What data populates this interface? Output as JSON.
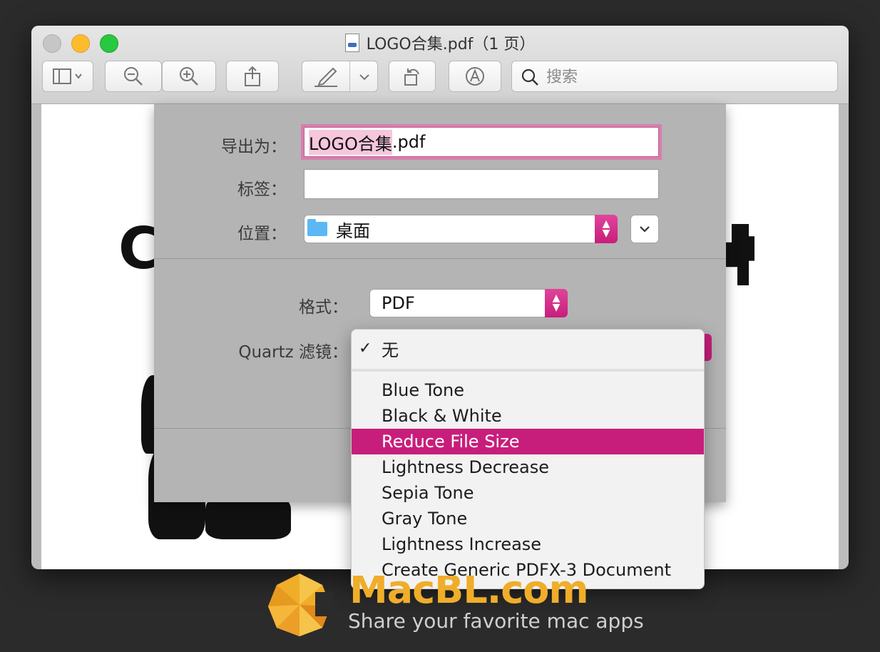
{
  "window": {
    "title": "LOGO合集.pdf（1 页）"
  },
  "toolbar": {
    "search_placeholder": "搜索",
    "icons": [
      "sidebar-icon",
      "zoom-out-icon",
      "zoom-in-icon",
      "share-icon",
      "markup-pen-icon",
      "rotate-icon",
      "annotate-icon",
      "search-icon"
    ]
  },
  "export_sheet": {
    "export_as_label": "导出为：",
    "export_as_value": "LOGO合集.pdf",
    "tags_label": "标签：",
    "tags_value": "",
    "location_label": "位置：",
    "location_value": "桌面",
    "format_label": "格式：",
    "format_value": "PDF",
    "quartz_filter_label": "Quartz 滤镜："
  },
  "filter_menu": {
    "checked_item": "无",
    "items": [
      "Blue Tone",
      "Black & White",
      "Reduce File Size",
      "Lightness Decrease",
      "Sepia Tone",
      "Gray Tone",
      "Lightness Increase",
      "Create Generic PDFX-3 Document"
    ],
    "highlighted_item": "Reduce File Size"
  },
  "document": {
    "visible_letter": "C"
  },
  "watermark": {
    "title": "MacBL.com",
    "subtitle": "Share your favorite mac apps"
  },
  "colors": {
    "accent": "#c81e7b",
    "watermark_orange": "#efad2a"
  }
}
